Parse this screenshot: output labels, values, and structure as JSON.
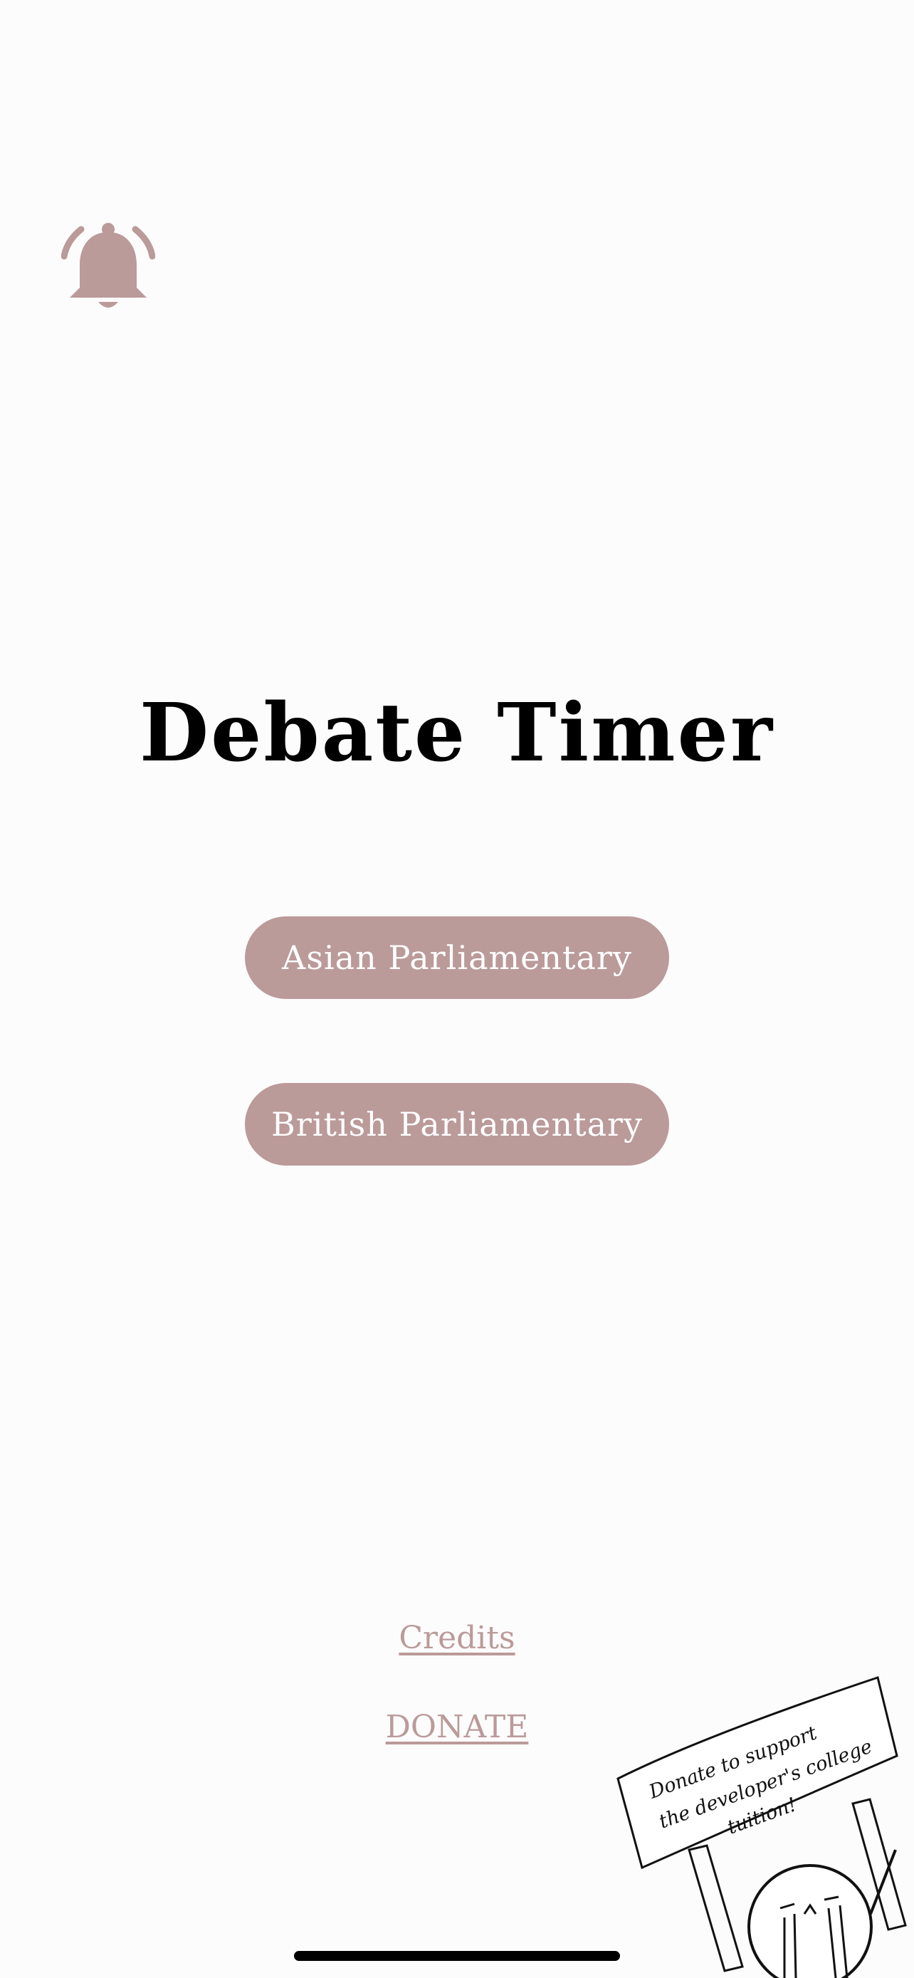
{
  "app": {
    "title": "Debate Timer",
    "accent_color": "#bb9a9a",
    "background_color": "#fdfcfc"
  },
  "header": {
    "alarm_icon": "bell-ringing-icon"
  },
  "modes": {
    "asian_parliamentary": "Asian Parliamentary",
    "british_parliamentary": "British Parliamentary"
  },
  "footer": {
    "credits_label": "Credits",
    "donate_label": "DONATE",
    "sign": {
      "line1": "Donate to support",
      "line2": "the developer's college",
      "line3": "tuition!"
    }
  }
}
